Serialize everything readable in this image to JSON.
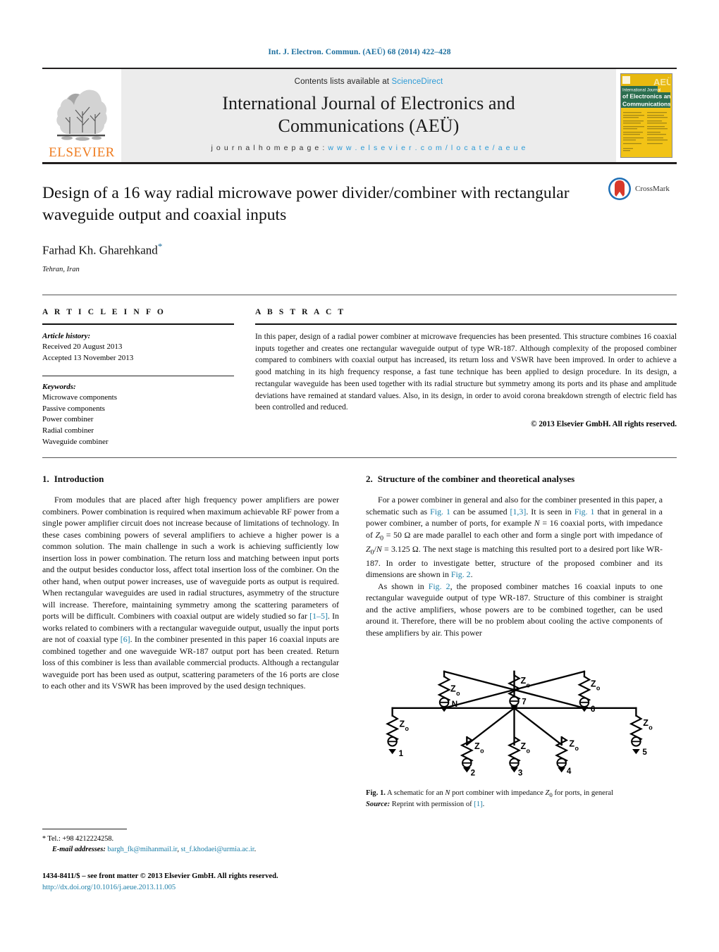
{
  "running_head": "Int. J. Electron. Commun. (AEÜ) 68 (2014) 422–428",
  "masthead": {
    "publisher_name": "ELSEVIER",
    "contents_prefix": "Contents lists available at ",
    "contents_link": "ScienceDirect",
    "journal_title_line1": "International Journal of Electronics and",
    "journal_title_line2": "Communications (AEÜ)",
    "homepage_prefix": "j o u r n a l   h o m e p a g e :  ",
    "homepage_url": "w w w . e l s e v i e r . c o m / l o c a t e / a e u e",
    "cover_line1": "International Journal",
    "cover_line2": "of Electronics and",
    "cover_line3": "Communications",
    "cover_logo": "AEÜ"
  },
  "title": {
    "text": "Design of a 16 way radial microwave power divider/combiner with rectangular waveguide output and coaxial inputs",
    "author": "Farhad Kh. Gharehkand",
    "author_marker": "*",
    "affiliation": "Tehran, Iran",
    "crossmark_label": "CrossMark"
  },
  "article_info": {
    "heading": "A R T I C L E    I N F O",
    "history_label": "Article history:",
    "received": "Received 20 August 2013",
    "accepted": "Accepted 13 November 2013",
    "keywords_label": "Keywords:",
    "keywords": [
      "Microwave components",
      "Passive components",
      "Power combiner",
      "Radial combiner",
      "Waveguide combiner"
    ]
  },
  "abstract": {
    "heading": "A B S T R A C T",
    "text": "In this paper, design of a radial power combiner at microwave frequencies has been presented. This structure combines 16 coaxial inputs together and creates one rectangular waveguide output of type WR-187. Although complexity of the proposed combiner compared to combiners with coaxial output has increased, its return loss and VSWR have been improved. In order to achieve a good matching in its high frequency response, a fast tune technique has been applied to design procedure. In its design, a rectangular waveguide has been used together with its radial structure but symmetry among its ports and its phase and amplitude deviations have remained at standard values. Also, in its design, in order to avoid corona breakdown strength of electric field has been controlled and reduced.",
    "copyright": "© 2013 Elsevier GmbH. All rights reserved."
  },
  "sections": {
    "intro": {
      "number": "1.",
      "heading": "Introduction",
      "para1_a": "From modules that are placed after high frequency power amplifiers are power combiners. Power combination is required when maximum achievable RF power from a single power amplifier circuit does not increase because of limitations of technology. In these cases combining powers of several amplifiers to achieve a higher power is a common solution. The main challenge in such a work is achieving sufficiently low insertion loss in power combination. The return loss and matching between input ports and the output besides conductor loss, affect total insertion loss of the combiner. On the other hand, when output power increases, use of waveguide ports as output is required. When rectangular waveguides are used in radial structures, asymmetry of the structure will increase. Therefore, maintaining symmetry among the scattering parameters of ports will be difficult. Combiners with coaxial output are widely studied so far ",
      "ref1": "[1–5]",
      "para1_b": ". In works related to combiners with a rectangular waveguide output, usually the input ports are not of coaxial type ",
      "ref2": "[6]",
      "para1_c": ". In the combiner presented in this paper 16 coaxial inputs are combined together and one waveguide WR-187 output port has been created. Return loss of this combiner is less than available commercial products. Although a rectangular waveguide port has been used as output, scattering parameters of the 16 ports are close to each other and its VSWR has been improved by the used design techniques."
    },
    "structure": {
      "number": "2.",
      "heading": "Structure of the combiner and theoretical analyses",
      "p1_a": "For a power combiner in general and also for the combiner presented in this paper, a schematic such as ",
      "p1_fig1a": "Fig. 1",
      "p1_b": " can be assumed ",
      "p1_ref": "[1,3]",
      "p1_c": ". It is seen in ",
      "p1_fig1b": "Fig. 1",
      "p1_d": " that in general in a power combiner, a number of ports, for example ",
      "p1_N": "N",
      "p1_e": " = 16 coaxial ports, with impedance of ",
      "p1_Z0": "Z",
      "p1_Z0sub": "0",
      "p1_f": " = 50 Ω are made parallel to each other and form a single port with impedance of ",
      "p1_Z0N": "Z",
      "p1_Z0Nsub": "0",
      "p1_g": "/",
      "p1_Nital": "N",
      "p1_h": " = 3.125 Ω. The next stage is matching this resulted port to a desired port like WR-187. In order to investigate better, structure of the proposed combiner and its dimensions are shown in ",
      "p1_fig2a": "Fig. 2",
      "p1_i": ".",
      "p2_a": "As shown in ",
      "p2_fig2": "Fig. 2",
      "p2_b": ", the proposed combiner matches 16 coaxial inputs to one rectangular waveguide output of type WR-187. Structure of this combiner is straight and the active amplifiers, whose powers are to be combined together, can be used around it. Therefore, there will be no problem about cooling the active components of these amplifiers by air. This power"
    }
  },
  "figure1": {
    "impedance_label": "Z",
    "impedance_sub": "o",
    "port_labels": [
      "1",
      "2",
      "3",
      "4",
      "5",
      "6",
      "7",
      "N"
    ],
    "caption_num": "Fig. 1.",
    "caption_a": " A schematic for an ",
    "caption_N": "N",
    "caption_b": " port combiner with impedance ",
    "caption_Z": "Z",
    "caption_Zsub": "0",
    "caption_c": " for ports, in general",
    "source_label": "Source:",
    "source_text": " Reprint with permission of ",
    "source_ref": "[1]",
    "source_end": "."
  },
  "footnotes": {
    "star": "*",
    "tel": " Tel.: +98 4212224258.",
    "email_label": "E-mail addresses:",
    "email1": "bargh_fk@mihanmail.ir",
    "email_sep": ", ",
    "email2": "st_f.khodaei@urmia.ac.ir",
    "email_end": ".",
    "issn": "1434-8411/$ – see front matter © 2013 Elsevier GmbH. All rights reserved.",
    "doi": "http://dx.doi.org/10.1016/j.aeue.2013.11.005"
  },
  "colors": {
    "link": "#1d7fa8",
    "sciencedirect": "#2b9ad6",
    "elsevier_orange": "#ef7d22",
    "masthead_bg": "#ececec"
  }
}
